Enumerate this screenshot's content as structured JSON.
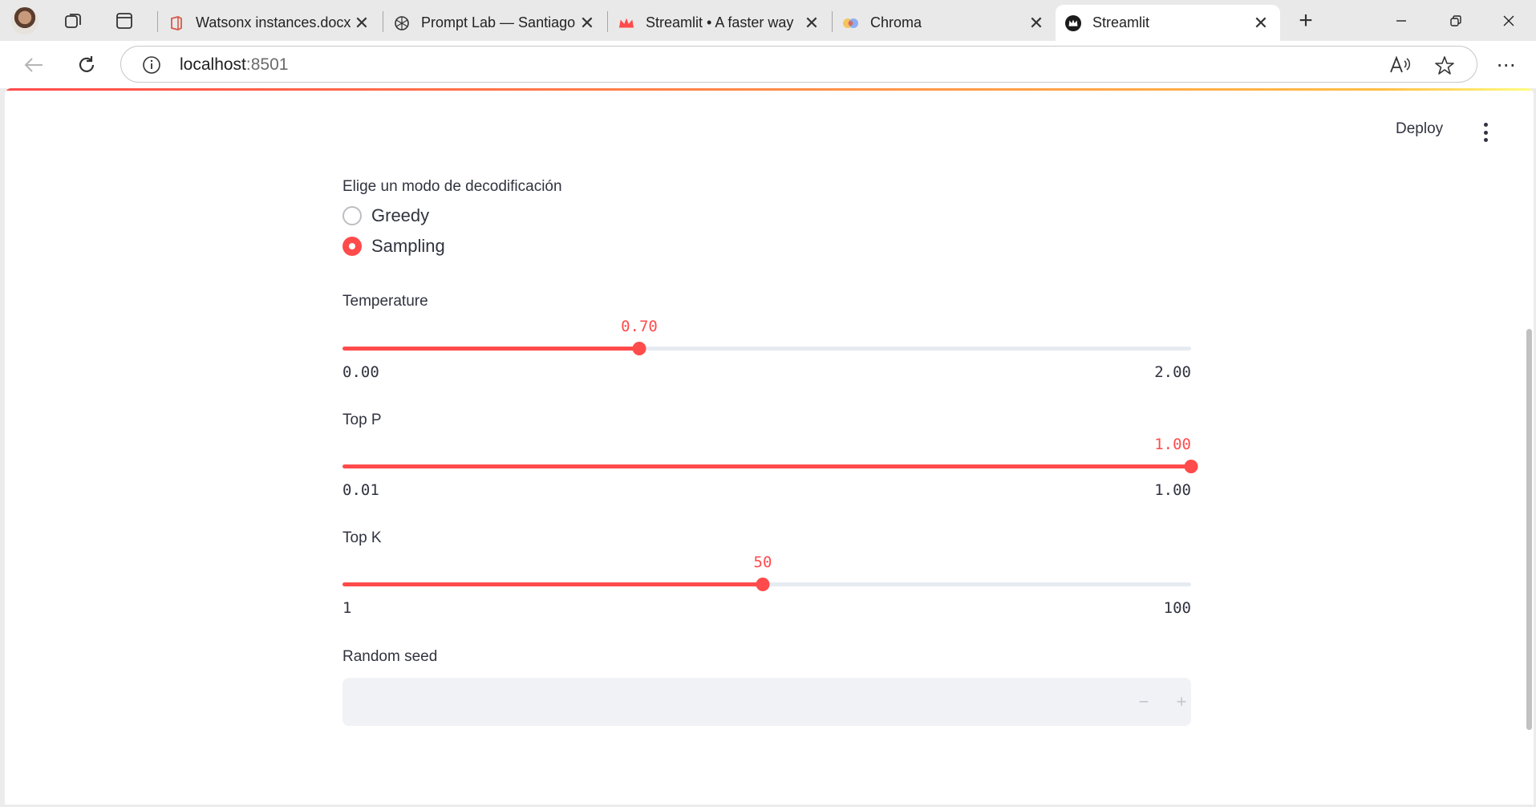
{
  "browser": {
    "tabs": [
      {
        "title": "Watsonx instances.docx",
        "icon": "office-icon"
      },
      {
        "title": "Prompt Lab — Santiago",
        "icon": "openai-icon"
      },
      {
        "title": "Streamlit • A faster way",
        "icon": "streamlit-crown-icon"
      },
      {
        "title": "Chroma",
        "icon": "chroma-icon"
      },
      {
        "title": "Streamlit",
        "icon": "streamlit-dark-icon",
        "active": true
      }
    ],
    "address": {
      "host": "localhost",
      "port": ":8501"
    }
  },
  "app": {
    "deploy_label": "Deploy",
    "decoding": {
      "label": "Elige un modo de decodificación",
      "options": [
        "Greedy",
        "Sampling"
      ],
      "selected": "Sampling"
    },
    "sliders": [
      {
        "label": "Temperature",
        "value": "0.70",
        "min": "0.00",
        "max": "2.00",
        "fraction": 0.35
      },
      {
        "label": "Top P",
        "value": "1.00",
        "min": "0.01",
        "max": "1.00",
        "fraction": 1.0
      },
      {
        "label": "Top K",
        "value": "50",
        "min": "1",
        "max": "100",
        "fraction": 0.4949
      }
    ],
    "seed": {
      "label": "Random seed",
      "value": "",
      "minus": "−",
      "plus": "+"
    }
  },
  "colors": {
    "accent": "#ff4b4b",
    "track": "#e6eaf1",
    "text": "#31333f"
  }
}
